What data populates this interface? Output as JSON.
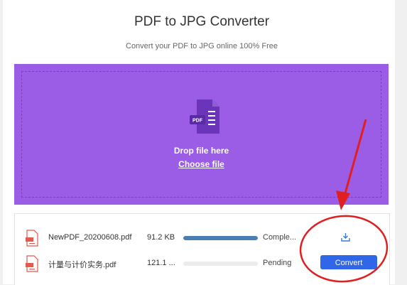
{
  "header": {
    "title": "PDF to JPG Converter",
    "subtitle": "Convert your PDF to JPG online 100% Free"
  },
  "dropzone": {
    "icon": "pdf-file-icon",
    "icon_label": "PDF",
    "drop_text": "Drop file here",
    "choose_label": "Choose file",
    "background_color": "#9b5de5"
  },
  "files": [
    {
      "name": "NewPDF_20200608.pdf",
      "size": "91.2 KB",
      "progress": 1.0,
      "status": "Comple...",
      "action_icon": "download-icon"
    },
    {
      "name": "计量与计价实务.pdf",
      "size": "121.1 ...",
      "progress": 0.0,
      "status": "Pending",
      "action_label": "Convert"
    }
  ],
  "colors": {
    "accent": "#2f67e8",
    "progress_complete": "#4a7fb5",
    "annotation": "#e02020"
  }
}
